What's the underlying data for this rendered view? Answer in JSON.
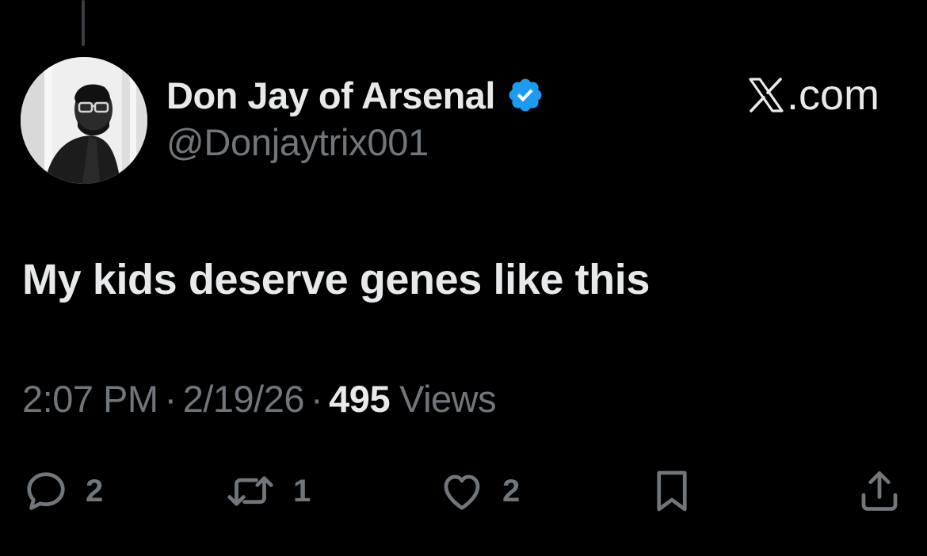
{
  "post": {
    "author": {
      "display_name": "Don Jay of Arsenal",
      "handle": "@Donjaytrix001",
      "verified": true,
      "avatar": "profile-photo-man-in-glasses-monochrome"
    },
    "source": {
      "label": ".com",
      "icon": "x-logo-icon"
    },
    "text": "My kids deserve genes like this",
    "meta": {
      "time": "2:07 PM",
      "separator": "·",
      "date": "2/19/26",
      "views_count": "495",
      "views_label": "Views"
    },
    "actions": {
      "replies": "2",
      "reposts": "1",
      "likes": "2"
    }
  },
  "colors": {
    "background": "#000000",
    "primary_text": "#e7e9ea",
    "secondary_text": "#71767b",
    "verified_blue": "#1d9bf0",
    "thread_line": "#3b3e42"
  }
}
